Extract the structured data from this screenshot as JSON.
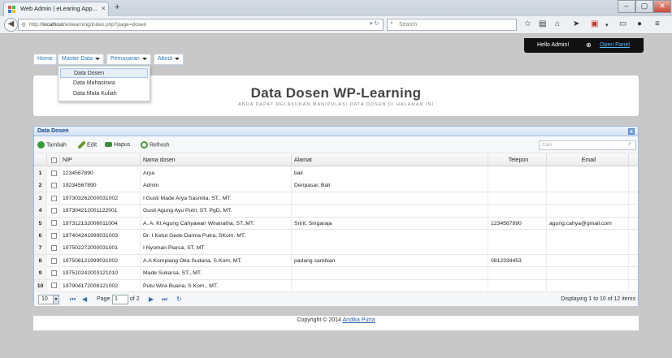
{
  "browser": {
    "tab_title": "Web Admin | eLearing App...",
    "tab_close": "×",
    "new_tab": "+",
    "url_prefix": "http://",
    "url_host": "localhost",
    "url_path": "/wslearning/index.php?page=dosen",
    "search_placeholder": "Search",
    "window_buttons": [
      "–",
      "▢",
      "✕"
    ]
  },
  "adminbar": {
    "greeting": "Hello Admin!",
    "open_panel": "Open Panel"
  },
  "menu": [
    {
      "label": "Home",
      "dropdown": false
    },
    {
      "label": "Master Data",
      "dropdown": true
    },
    {
      "label": "Pemasaran",
      "dropdown": true
    },
    {
      "label": "About",
      "dropdown": true
    }
  ],
  "dropdown_items": [
    "Data Dosen",
    "Data Mahasiswa",
    "Data Mata Kuliah"
  ],
  "header": {
    "title": "Data Dosen WP-Learning",
    "subtitle": "ANDA DAPAT MELAKUKAN MANIPULASI DATA DOSEN DI HALAMAN INI"
  },
  "grid": {
    "panel_title": "Data Dosen",
    "toolbar": {
      "add": "Tambah",
      "edit": "Edit",
      "delete": "Hapus",
      "refresh": "Refresh"
    },
    "search_placeholder": "Cari",
    "columns": [
      "NIP",
      "Nama dosen",
      "Alamat",
      "Telepon",
      "Email"
    ],
    "rows": [
      {
        "no": "1",
        "nip": "1234567890",
        "nama": "Arya",
        "alamat": "bali",
        "telepon": "",
        "email": ""
      },
      {
        "no": "2",
        "nip": "19234567890",
        "nama": "Admin",
        "alamat": "Denpasar, Bali",
        "telepon": "",
        "email": ""
      },
      {
        "no": "3",
        "nip": "197303262000031002",
        "nama": "I Gusti Made Arya Sasmita, ST., MT.",
        "alamat": "",
        "telepon": "",
        "email": ""
      },
      {
        "no": "4",
        "nip": "197304212001122001",
        "nama": "Gusti Agung Ayu Putri, ST. PgD, MT.",
        "alamat": "",
        "telepon": "",
        "email": ""
      },
      {
        "no": "5",
        "nip": "197312132006011004",
        "nama": "A. A. Kt Agung Cahyawan Wiranatha, ST.,MT.",
        "alamat": "Sririt, Singaraja",
        "telepon": "1234567890",
        "email": "agung.cahya@gmail.com"
      },
      {
        "no": "6",
        "nip": "197404241999031003",
        "nama": "Dr. I Ketut Gede Darma Putra, SKom. MT.",
        "alamat": "",
        "telepon": "",
        "email": ""
      },
      {
        "no": "7",
        "nip": "197502272000031001",
        "nama": "I Nyoman Piarsa, ST, MT",
        "alamat": "",
        "telepon": "",
        "email": ""
      },
      {
        "no": "8",
        "nip": "197506121999031002",
        "nama": "A.A Kompiang Oka Sudana, S.Kom, MT.",
        "alamat": "padang sambian",
        "telepon": "0812334453",
        "email": ""
      },
      {
        "no": "9",
        "nip": "197510242003121010",
        "nama": "Made Sukarsa, ST., MT.",
        "alamat": "",
        "telepon": "",
        "email": ""
      },
      {
        "no": "10",
        "nip": "197904172008121002",
        "nama": "Putu Wira Buana, S.Kom., MT.",
        "alamat": "",
        "telepon": "",
        "email": ""
      }
    ],
    "pager": {
      "page_size": "10",
      "page_label": "Page",
      "page_value": "1",
      "of_label": "of 2",
      "display_text": "Displaying 1 to 10 of 12 items"
    }
  },
  "footer": {
    "text": "Copyright © 2014",
    "author": "Andika Putra"
  },
  "colors": {
    "accent": "#2a7ab8",
    "panel_border": "#99bbe8",
    "panel_title": "#15428b"
  }
}
